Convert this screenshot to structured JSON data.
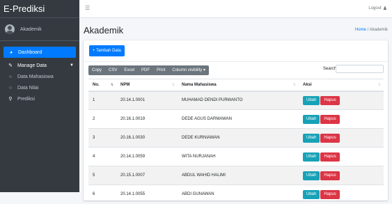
{
  "brand": {
    "title": "E-Prediksi"
  },
  "user": {
    "name": "Akademik"
  },
  "sidebar": {
    "items": [
      {
        "label": "Dashboard",
        "icon": "dashboard-icon"
      },
      {
        "label": "Manage Data",
        "icon": "edit-icon"
      },
      {
        "label": "Data Mahasiswa",
        "icon": "circle-icon"
      },
      {
        "label": "Data Nilai",
        "icon": "circle-icon"
      },
      {
        "label": "Prediksi",
        "icon": "search-icon"
      }
    ]
  },
  "topbar": {
    "logout": "Logout"
  },
  "page": {
    "title": "Akademik"
  },
  "breadcrumb": {
    "home": "Home",
    "separator": "/",
    "current": "Akademik"
  },
  "toolbar": {
    "add_label": "+ Tambah Data",
    "copy": "Copy",
    "csv": "CSV",
    "excel": "Excel",
    "pdf": "PDF",
    "print": "Print",
    "column_visibility": "Column visibility ▾"
  },
  "search": {
    "label": "Search:",
    "value": ""
  },
  "table": {
    "headers": {
      "no": "No.",
      "npm": "NPM",
      "nama": "Nama Mahasiswa",
      "aksi": "Aksi"
    },
    "rows": [
      {
        "no": "1",
        "npm": "20.14.1.0001",
        "nama": "MUHAMAD DENDI PURWANTO"
      },
      {
        "no": "2",
        "npm": "20.16.1.0019",
        "nama": "DEDE AGUS DARMAWAN"
      },
      {
        "no": "3",
        "npm": "20.16.1.0030",
        "nama": "DEDE KURNIAWAN"
      },
      {
        "no": "4",
        "npm": "20.14.1.0059",
        "nama": "WITA NURJANAH"
      },
      {
        "no": "5",
        "npm": "20.15.1.0007",
        "nama": "ABDUL WAHID HALIMI"
      },
      {
        "no": "6",
        "npm": "20.14.1.0055",
        "nama": "ABDI GUNAWAN"
      }
    ],
    "ubah_label": "Ubah",
    "hapus_label": "Hapus"
  },
  "colors": {
    "sidebar": "#343a40",
    "primary": "#007bff",
    "info": "#17a2b8",
    "danger": "#dc3545",
    "secondary": "#6c757d"
  }
}
